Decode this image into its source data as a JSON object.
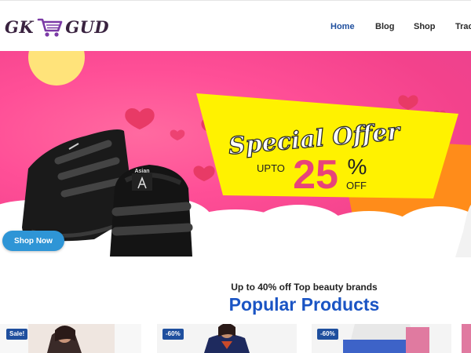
{
  "header": {
    "logo_left": "GK",
    "logo_right": "GUD",
    "logo_icon": "shopping-cart-icon",
    "nav": [
      {
        "label": "Home",
        "active": true
      },
      {
        "label": "Blog",
        "active": false
      },
      {
        "label": "Shop",
        "active": false
      },
      {
        "label": "Trac",
        "active": false
      }
    ]
  },
  "hero": {
    "offer_title": "Special Offer",
    "upto": "UPTO",
    "percent": "25",
    "percent_sign": "%",
    "off": "OFF",
    "brand_name": "Asian",
    "shop_now": "Shop Now",
    "colors": {
      "background": "#f3428c",
      "ribbon": "#fff200",
      "accent": "#e8437a",
      "button": "#2e95d6"
    }
  },
  "popular": {
    "subheading": "Up to 40% off Top beauty brands",
    "title": "Popular Products",
    "title_color": "#1a54c4",
    "cards": [
      {
        "badge": "Sale!"
      },
      {
        "badge": "-60%"
      },
      {
        "badge": "-60%"
      }
    ]
  }
}
